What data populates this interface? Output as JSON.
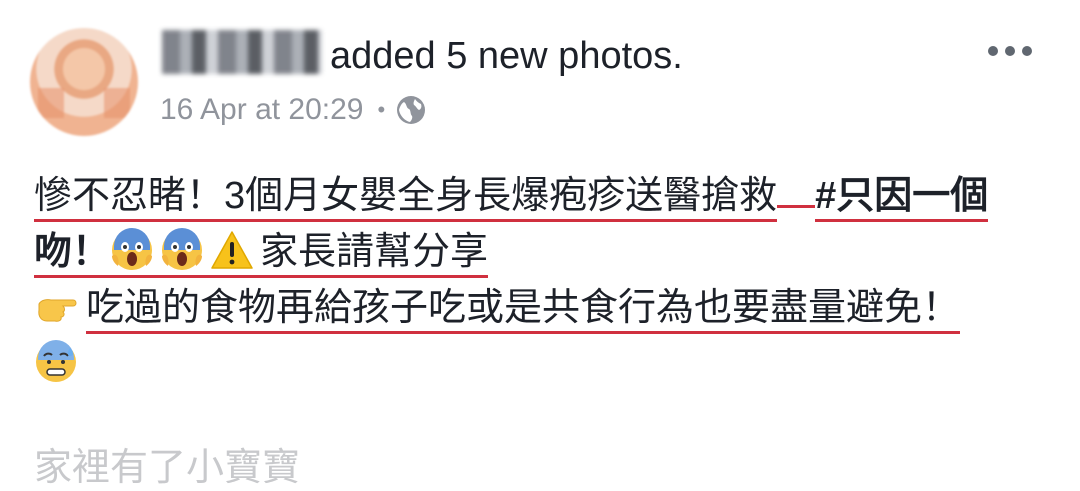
{
  "post": {
    "author_name": "",
    "action": "added 5 new photos.",
    "timestamp": "16 Apr at 20:29",
    "separator": "•",
    "privacy_icon": "globe-icon",
    "more_icon": "more-horizontal-icon"
  },
  "content": {
    "line1_a": "慘不忍睹！3個月女嬰全身長爆疱疹送醫搶救",
    "line1_b": "#只因一個",
    "line2_a": "吻！",
    "line2_emojis": [
      "scream-emoji",
      "scream-emoji",
      "warning-emoji"
    ],
    "line2_b": "家長請幫分享",
    "line3_emoji": "pointing-right-emoji",
    "line3": "吃過的食物再給孩子吃或是共食行為也要盡量避免！",
    "line4_emoji": "anxious-sweat-emoji",
    "faded_text": "家裡有了小寶寶"
  },
  "colors": {
    "underline": "#d0303f",
    "text": "#1d2129",
    "meta": "#90949c"
  }
}
